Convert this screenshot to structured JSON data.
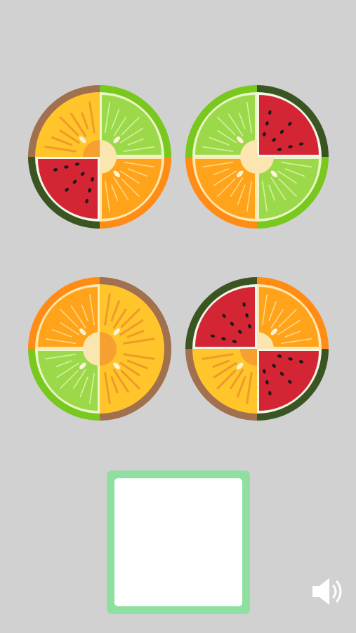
{
  "board": {
    "fruits": [
      {
        "id": "fruit-0",
        "quadrants": [
          "orange-dark",
          "lime",
          "watermelon",
          "orange"
        ]
      },
      {
        "id": "fruit-1",
        "quadrants": [
          "lime",
          "watermelon",
          "orange",
          "lime"
        ]
      },
      {
        "id": "fruit-2",
        "quadrants": [
          "orange",
          "orange-dark",
          "lime",
          "orange-dark"
        ]
      },
      {
        "id": "fruit-3",
        "quadrants": [
          "watermelon",
          "orange",
          "orange-dark",
          "watermelon"
        ]
      }
    ]
  },
  "slot": {
    "state": "empty"
  },
  "sound": {
    "icon": "speaker-icon",
    "enabled": true
  },
  "colors": {
    "background": "#d1d1d1",
    "slot_border": "#8fe0a0",
    "lime": "#9cd94a",
    "orange": "#ffa31a",
    "orange_dark": "#ffc52b",
    "watermelon": "#d42535"
  }
}
